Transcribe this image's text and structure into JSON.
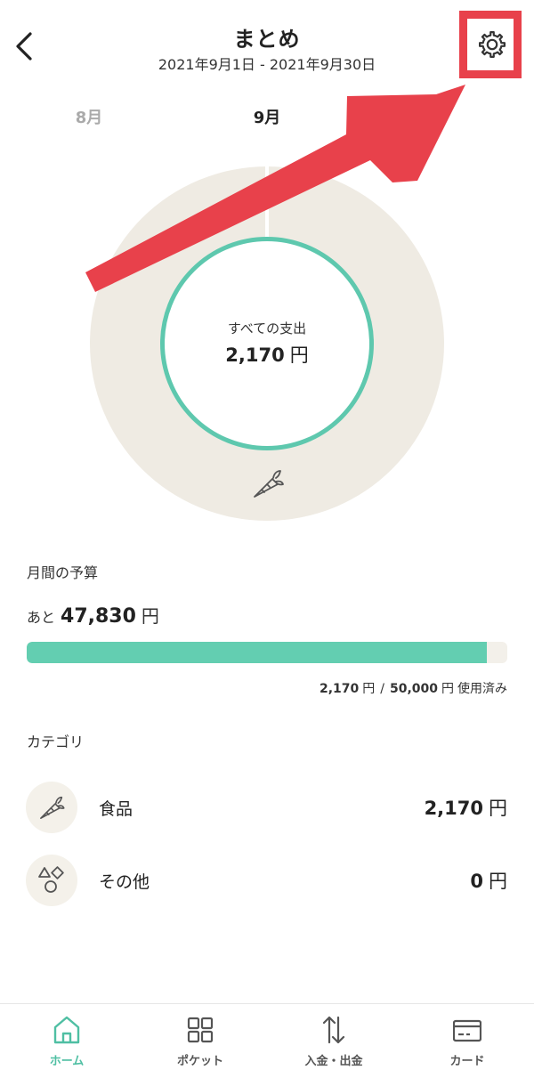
{
  "header": {
    "title": "まとめ",
    "date_range": "2021年9月1日 - 2021年9月30日",
    "back_icon": "chevron-left-icon",
    "settings_icon": "gear-icon"
  },
  "month_tabs": [
    {
      "label": "8月",
      "active": false
    },
    {
      "label": "9月",
      "active": true
    }
  ],
  "donut": {
    "label": "すべての支出",
    "value": "2,170",
    "unit": "円",
    "segment_icon": "carrot-icon"
  },
  "budget": {
    "heading": "月間の予算",
    "remaining_prefix": "あと",
    "remaining_value": "47,830",
    "remaining_unit": "円",
    "progress_fraction": 0.9566,
    "used_value": "2,170",
    "used_unit": "円",
    "separator": "/",
    "total_value": "50,000",
    "total_unit": "円",
    "used_suffix": "使用済み"
  },
  "categories": {
    "heading": "カテゴリ",
    "items": [
      {
        "name": "食品",
        "amount": "2,170",
        "unit": "円",
        "icon": "carrot-icon"
      },
      {
        "name": "その他",
        "amount": "0",
        "unit": "円",
        "icon": "shapes-icon"
      }
    ]
  },
  "bottom_nav": {
    "items": [
      {
        "label": "ホーム",
        "icon": "home-icon",
        "active": true
      },
      {
        "label": "ポケット",
        "icon": "grid-icon",
        "active": false
      },
      {
        "label": "入金・出金",
        "icon": "transfer-arrows-icon",
        "active": false
      },
      {
        "label": "カード",
        "icon": "card-icon",
        "active": false
      }
    ]
  },
  "colors": {
    "accent": "#5ec8ae",
    "progress": "#63ceb1",
    "highlight": "#e8414b",
    "donut_track": "#efebe3"
  }
}
